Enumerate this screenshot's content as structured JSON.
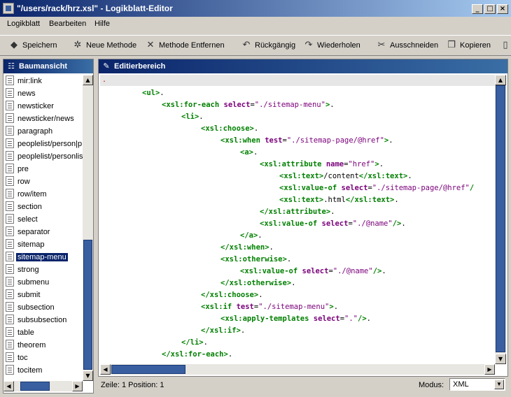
{
  "window": {
    "title": "\"/users/rack/hrz.xsl\" - Logikblatt-Editor",
    "controls": [
      "_",
      "□",
      "×"
    ]
  },
  "menu": [
    "Logikblatt",
    "Bearbeiten",
    "Hilfe"
  ],
  "toolbar": [
    {
      "label": "Speichern",
      "icon": "save-icon"
    },
    {
      "label": "Neue Methode",
      "icon": "new-method-icon"
    },
    {
      "label": "Methode Entfernen",
      "icon": "remove-method-icon"
    },
    {
      "label": "Rückgängig",
      "icon": "undo-icon"
    },
    {
      "label": "Wiederholen",
      "icon": "redo-icon"
    },
    {
      "label": "Ausschneiden",
      "icon": "cut-icon"
    },
    {
      "label": "Kopieren",
      "icon": "copy-icon"
    }
  ],
  "tree": {
    "title": "Baumansicht",
    "items": [
      "mir:link",
      "news",
      "newsticker",
      "newsticker/news",
      "paragraph",
      "peoplelist/person|p",
      "peoplelist/personlis",
      "pre",
      "row",
      "row/item",
      "section",
      "select",
      "separator",
      "sitemap",
      "sitemap-menu",
      "strong",
      "submenu",
      "submit",
      "subsection",
      "subsubsection",
      "table",
      "theorem",
      "toc",
      "tocitem"
    ],
    "selected_index": 14
  },
  "editor": {
    "title": "Editierbereich",
    "lines": [
      [
        [
          "tag",
          "<ul>"
        ],
        [
          "txt",
          "."
        ]
      ],
      [
        [
          "tag",
          "<xsl:for-each "
        ],
        [
          "attr",
          "select"
        ],
        [
          "txt",
          "="
        ],
        [
          "val",
          "\"./sitemap-menu\""
        ],
        [
          "tag",
          ">"
        ],
        [
          "txt",
          "."
        ]
      ],
      [
        [
          "tag",
          "<li>"
        ],
        [
          "txt",
          "."
        ]
      ],
      [
        [
          "tag",
          "<xsl:choose>"
        ],
        [
          "txt",
          "."
        ]
      ],
      [
        [
          "tag",
          "<xsl:when "
        ],
        [
          "attr",
          "test"
        ],
        [
          "txt",
          "="
        ],
        [
          "val",
          "\"./sitemap-page/@href\""
        ],
        [
          "tag",
          ">"
        ],
        [
          "txt",
          "."
        ]
      ],
      [
        [
          "tag",
          "<a>"
        ],
        [
          "txt",
          "."
        ]
      ],
      [
        [
          "tag",
          "<xsl:attribute "
        ],
        [
          "attr",
          "name"
        ],
        [
          "txt",
          "="
        ],
        [
          "val",
          "\"href\""
        ],
        [
          "tag",
          ">"
        ],
        [
          "txt",
          "."
        ]
      ],
      [
        [
          "tag",
          "<xsl:text>"
        ],
        [
          "txt",
          "/content"
        ],
        [
          "tag",
          "</xsl:text>"
        ],
        [
          "txt",
          "."
        ]
      ],
      [
        [
          "tag",
          "<xsl:value-of "
        ],
        [
          "attr",
          "select"
        ],
        [
          "txt",
          "="
        ],
        [
          "val",
          "\"./sitemap-page/@href\""
        ],
        [
          "tag",
          "/"
        ]
      ],
      [
        [
          "tag",
          "<xsl:text>"
        ],
        [
          "txt",
          ".html"
        ],
        [
          "tag",
          "</xsl:text>"
        ],
        [
          "txt",
          "."
        ]
      ],
      [
        [
          "tag",
          "</xsl:attribute>"
        ],
        [
          "txt",
          "."
        ]
      ],
      [
        [
          "tag",
          "<xsl:value-of "
        ],
        [
          "attr",
          "select"
        ],
        [
          "txt",
          "="
        ],
        [
          "val",
          "\"./@name\""
        ],
        [
          "tag",
          "/>"
        ],
        [
          "txt",
          "."
        ]
      ],
      [
        [
          "tag",
          "</a>"
        ],
        [
          "txt",
          "."
        ]
      ],
      [
        [
          "tag",
          "</xsl:when>"
        ],
        [
          "txt",
          "."
        ]
      ],
      [
        [
          "tag",
          "<xsl:otherwise>"
        ],
        [
          "txt",
          "."
        ]
      ],
      [
        [
          "tag",
          "<xsl:value-of "
        ],
        [
          "attr",
          "select"
        ],
        [
          "txt",
          "="
        ],
        [
          "val",
          "\"./@name\""
        ],
        [
          "tag",
          "/>"
        ],
        [
          "txt",
          "."
        ]
      ],
      [
        [
          "tag",
          "</xsl:otherwise>"
        ],
        [
          "txt",
          "."
        ]
      ],
      [
        [
          "tag",
          "</xsl:choose>"
        ],
        [
          "txt",
          "."
        ]
      ],
      [
        [
          "tag",
          "<xsl:if "
        ],
        [
          "attr",
          "test"
        ],
        [
          "txt",
          "="
        ],
        [
          "val",
          "\"./sitemap-menu\""
        ],
        [
          "tag",
          ">"
        ],
        [
          "txt",
          "."
        ]
      ],
      [
        [
          "tag",
          "<xsl:apply-templates "
        ],
        [
          "attr",
          "select"
        ],
        [
          "txt",
          "="
        ],
        [
          "val",
          "\".\""
        ],
        [
          "tag",
          "/>"
        ],
        [
          "txt",
          "."
        ]
      ],
      [
        [
          "tag",
          "</xsl:if>"
        ],
        [
          "txt",
          "."
        ]
      ],
      [
        [
          "tag",
          "</li>"
        ],
        [
          "txt",
          "."
        ]
      ],
      [
        [
          "tag",
          "</xsl:for-each>"
        ],
        [
          "txt",
          "."
        ]
      ]
    ],
    "indent_levels": [
      2,
      3,
      4,
      5,
      6,
      7,
      8,
      9,
      9,
      9,
      8,
      8,
      7,
      6,
      6,
      7,
      6,
      5,
      5,
      6,
      5,
      4,
      3
    ]
  },
  "status": {
    "position": "Zeile: 1 Position: 1",
    "mode_label": "Modus:",
    "mode_value": "XML"
  },
  "colors": {
    "titlebar_start": "#0a246a",
    "titlebar_end": "#a6caf0",
    "tag": "#008000",
    "attribute": "#7a007a",
    "selection": "#0a246a"
  }
}
